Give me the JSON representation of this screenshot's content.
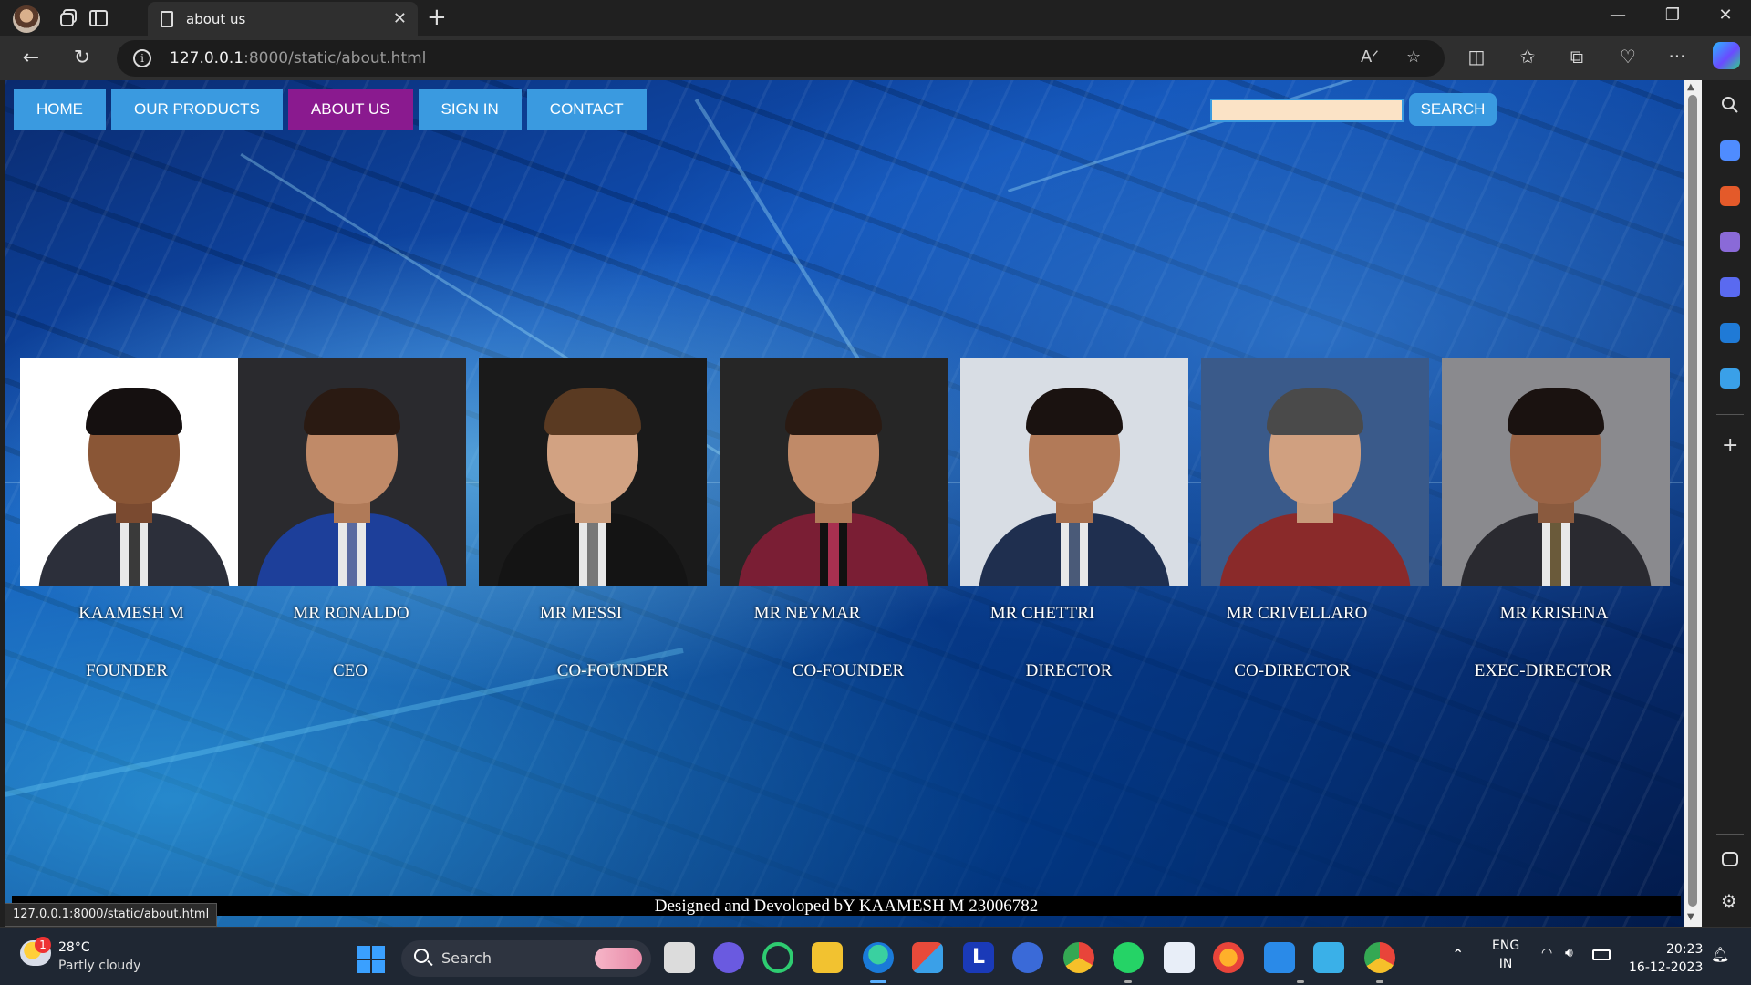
{
  "browser": {
    "tab_title": "about us",
    "url_host": "127.0.0.1",
    "url_rest": ":8000/static/about.html",
    "status_url": "127.0.0.1:8000/static/about.html"
  },
  "page": {
    "nav": [
      "HOME",
      "OUR PRODUCTS",
      "ABOUT US",
      "SIGN IN",
      "CONTACT"
    ],
    "active_nav": "ABOUT US",
    "search_value": "",
    "search_button": "SEARCH",
    "accent_color": "#3a9ae0",
    "active_color": "#8a1a8f",
    "team": [
      {
        "name": "KAAMESH M",
        "role": "FOUNDER"
      },
      {
        "name": "MR RONALDO",
        "role": "CEO"
      },
      {
        "name": "MR MESSI",
        "role": "CO-FOUNDER"
      },
      {
        "name": "MR NEYMAR",
        "role": "CO-FOUNDER"
      },
      {
        "name": "MR CHETTRI",
        "role": "DIRECTOR"
      },
      {
        "name": "MR CRIVELLARO",
        "role": "CO-DIRECTOR"
      },
      {
        "name": "MR KRISHNA",
        "role": "EXEC-DIRECTOR"
      }
    ],
    "footer": "Designed and Devoloped bY KAAMESH M 23006782"
  },
  "taskbar": {
    "weather_temp": "28°C",
    "weather_desc": "Partly cloudy",
    "weather_badge": "1",
    "search_label": "Search",
    "lang_line1": "ENG",
    "lang_line2": "IN",
    "time": "20:23",
    "date": "16-12-2023"
  }
}
